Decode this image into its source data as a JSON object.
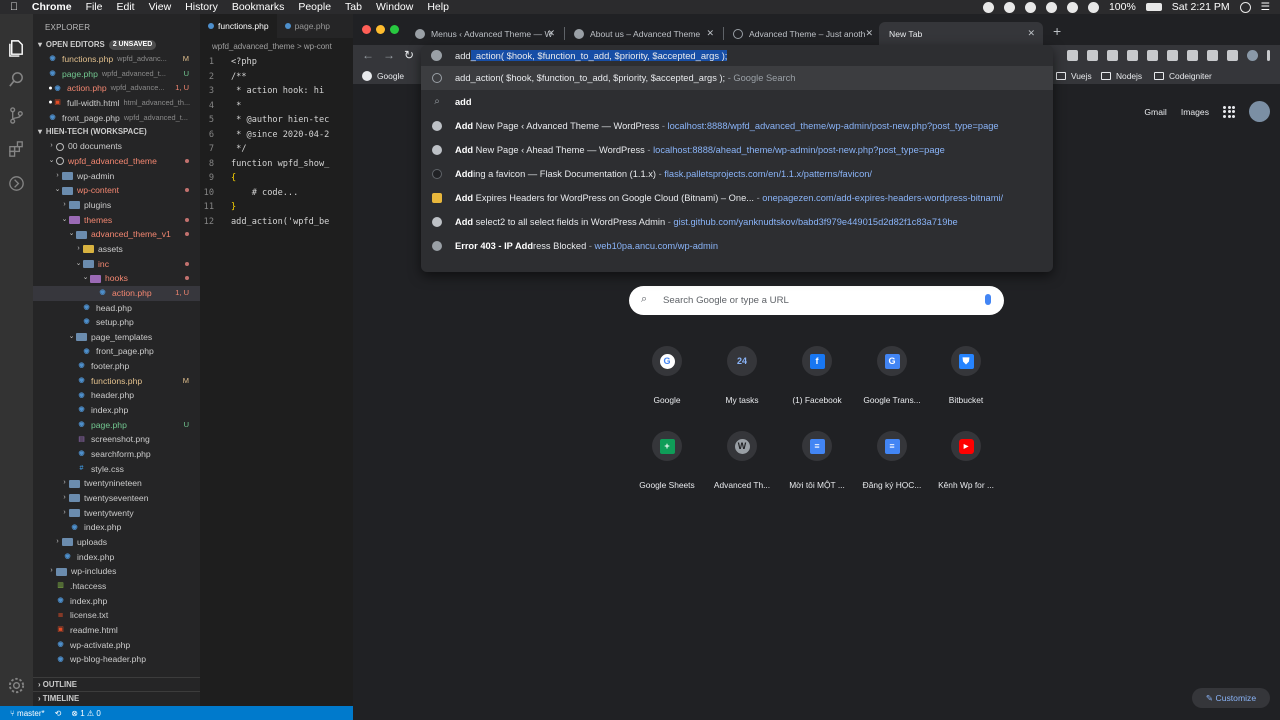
{
  "mac_menubar": {
    "app_name": "Chrome",
    "menus": [
      "File",
      "Edit",
      "View",
      "History",
      "Bookmarks",
      "People",
      "Tab",
      "Window",
      "Help"
    ],
    "battery": "100%",
    "clock": "Sat 2:21 PM"
  },
  "vscode": {
    "explorer_title": "EXPLORER",
    "open_editors": {
      "title": "OPEN EDITORS",
      "badge": "2 UNSAVED"
    },
    "open_files": [
      {
        "name": "functions.php",
        "path": "wpfd_advanc...",
        "status": "M"
      },
      {
        "name": "page.php",
        "path": "wpfd_advanced_t...",
        "status": "U"
      },
      {
        "name": "action.php",
        "path": "wpfd_advance...",
        "status": "1, U"
      },
      {
        "name": "full-width.html",
        "path": "html_advanced_th...",
        "status": ""
      },
      {
        "name": "front_page.php",
        "path": "wpfd_advanced_t...",
        "status": ""
      }
    ],
    "workspace_title": "HIEN-TECH (WORKSPACE)",
    "tree": [
      {
        "name": "00 documents",
        "status": ""
      },
      {
        "name": "wpfd_advanced_theme",
        "status": ""
      },
      {
        "name": "wp-admin",
        "status": ""
      },
      {
        "name": "wp-content",
        "status": ""
      },
      {
        "name": "plugins",
        "status": ""
      },
      {
        "name": "themes",
        "status": ""
      },
      {
        "name": "advanced_theme_v1",
        "status": ""
      },
      {
        "name": "assets",
        "status": ""
      },
      {
        "name": "inc",
        "status": ""
      },
      {
        "name": "hooks",
        "status": ""
      },
      {
        "name": "action.php",
        "status": "1, U"
      },
      {
        "name": "head.php",
        "status": ""
      },
      {
        "name": "setup.php",
        "status": ""
      },
      {
        "name": "page_templates",
        "status": ""
      },
      {
        "name": "front_page.php",
        "status": ""
      },
      {
        "name": "footer.php",
        "status": ""
      },
      {
        "name": "functions.php",
        "status": "M"
      },
      {
        "name": "header.php",
        "status": ""
      },
      {
        "name": "index.php",
        "status": ""
      },
      {
        "name": "page.php",
        "status": "U"
      },
      {
        "name": "screenshot.png",
        "status": ""
      },
      {
        "name": "searchform.php",
        "status": ""
      },
      {
        "name": "style.css",
        "status": ""
      },
      {
        "name": "twentynineteen",
        "status": ""
      },
      {
        "name": "twentyseventeen",
        "status": ""
      },
      {
        "name": "twentytwenty",
        "status": ""
      },
      {
        "name": "index.php",
        "status": ""
      },
      {
        "name": "uploads",
        "status": ""
      },
      {
        "name": "index.php",
        "status": ""
      },
      {
        "name": "wp-includes",
        "status": ""
      },
      {
        "name": ".htaccess",
        "status": ""
      },
      {
        "name": "index.php",
        "status": ""
      },
      {
        "name": "license.txt",
        "status": ""
      },
      {
        "name": "readme.html",
        "status": ""
      },
      {
        "name": "wp-activate.php",
        "status": ""
      },
      {
        "name": "wp-blog-header.php",
        "status": ""
      }
    ],
    "outline": "OUTLINE",
    "timeline": "TIMELINE",
    "tabs": [
      "functions.php",
      "page.php"
    ],
    "breadcrumb": "wpfd_advanced_theme > wp-cont",
    "code_lines": [
      {
        "n": "1",
        "text": "<?php"
      },
      {
        "n": "2",
        "text": "/**"
      },
      {
        "n": "3",
        "text": " * action hook: hi"
      },
      {
        "n": "4",
        "text": " *"
      },
      {
        "n": "5",
        "text": " * @author hien-tec"
      },
      {
        "n": "6",
        "text": " * @since 2020-04-2"
      },
      {
        "n": "7",
        "text": " */"
      },
      {
        "n": "8",
        "text": "function wpfd_show_"
      },
      {
        "n": "9",
        "text": "{"
      },
      {
        "n": "10",
        "text": "    # code..."
      },
      {
        "n": "11",
        "text": "}"
      },
      {
        "n": "12",
        "text": "add_action('wpfd_be"
      }
    ],
    "status": {
      "branch": "master*",
      "problems": "1",
      "warnings": "0"
    }
  },
  "chrome": {
    "tabs": [
      {
        "title": "Menus ‹ Advanced Theme — W",
        "active": false
      },
      {
        "title": "About us – Advanced Theme",
        "active": false
      },
      {
        "title": "Advanced Theme – Just anoth",
        "active": false
      },
      {
        "title": "New Tab",
        "active": true
      }
    ],
    "omnibox": {
      "typed": "add",
      "autocomplete": "_action( $hook, $function_to_add, $priority, $accepted_args );"
    },
    "suggestions": [
      {
        "icon": "clock",
        "bold": "add_action( $hook, $function_to_add, $priority, $accepted_args );",
        "sep": " - ",
        "url": "Google Search",
        "is_search": true
      },
      {
        "icon": "mag",
        "bold": "add",
        "sep": "",
        "url": "",
        "is_search": false
      },
      {
        "icon": "wp",
        "bold": "Add",
        "rest": " New Page ‹ Advanced Theme — WordPress",
        "sep": " - ",
        "url": "localhost:8888/wpfd_advanced_theme/wp-admin/post-new.php?post_type=page"
      },
      {
        "icon": "wp",
        "bold": "Add",
        "rest": " New Page ‹ Ahead Theme — WordPress",
        "sep": " - ",
        "url": "localhost:8888/ahead_theme/wp-admin/post-new.php?post_type=page"
      },
      {
        "icon": "dark",
        "bold": "Add",
        "rest": "ing a favicon — Flask Documentation (1.1.x)",
        "sep": " - ",
        "url": "flask.palletsprojects.com/en/1.1.x/patterns/favicon/"
      },
      {
        "icon": "yel",
        "bold": "Add",
        "rest": " Expires Headers for WordPress on Google Cloud (Bitnami) – One...",
        "sep": " - ",
        "url": "onepagezen.com/add-expires-headers-wordpress-bitnami/"
      },
      {
        "icon": "git",
        "bold": "Add",
        "rest": " select2 to all select fields in WordPress Admin",
        "sep": " - ",
        "url": "gist.github.com/yanknudtskov/babd3f979e449015d2d82f1c83a719be"
      },
      {
        "icon": "globe",
        "bold": "Error 403 - IP Add",
        "rest": "ress Blocked",
        "sep": " - ",
        "url": "web10pa.ancu.com/wp-admin"
      }
    ],
    "bookmarks": [
      {
        "label": "Google",
        "kind": "google"
      },
      {
        "label": "Vuejs",
        "kind": "folder"
      },
      {
        "label": "Nodejs",
        "kind": "folder"
      },
      {
        "label": "Codeigniter",
        "kind": "folder"
      }
    ],
    "ntp": {
      "gmail": "Gmail",
      "images": "Images",
      "search_placeholder": "Search Google or type a URL",
      "shortcuts_row1": [
        {
          "label": "Google",
          "glyph": "G",
          "color": "#35363a"
        },
        {
          "label": "My tasks",
          "glyph": "24",
          "color": "#35363a"
        },
        {
          "label": "(1) Facebook",
          "glyph": "f",
          "color": "#1877f2"
        },
        {
          "label": "Google Trans...",
          "glyph": "G",
          "color": "#4285f4"
        },
        {
          "label": "Bitbucket",
          "glyph": "⛊",
          "color": "#2684ff"
        }
      ],
      "shortcuts_row2": [
        {
          "label": "Google Sheets",
          "glyph": "+",
          "color": "#0f9d58"
        },
        {
          "label": "Advanced Th...",
          "glyph": "W",
          "color": "#9aa0a6"
        },
        {
          "label": "Mời tôi MỘT ...",
          "glyph": "≡",
          "color": "#4285f4"
        },
        {
          "label": "Đăng ký HỌC...",
          "glyph": "≡",
          "color": "#4285f4"
        },
        {
          "label": "Kênh Wp for ...",
          "glyph": "▶",
          "color": "#ff0000"
        }
      ],
      "customize": "Customize"
    }
  }
}
